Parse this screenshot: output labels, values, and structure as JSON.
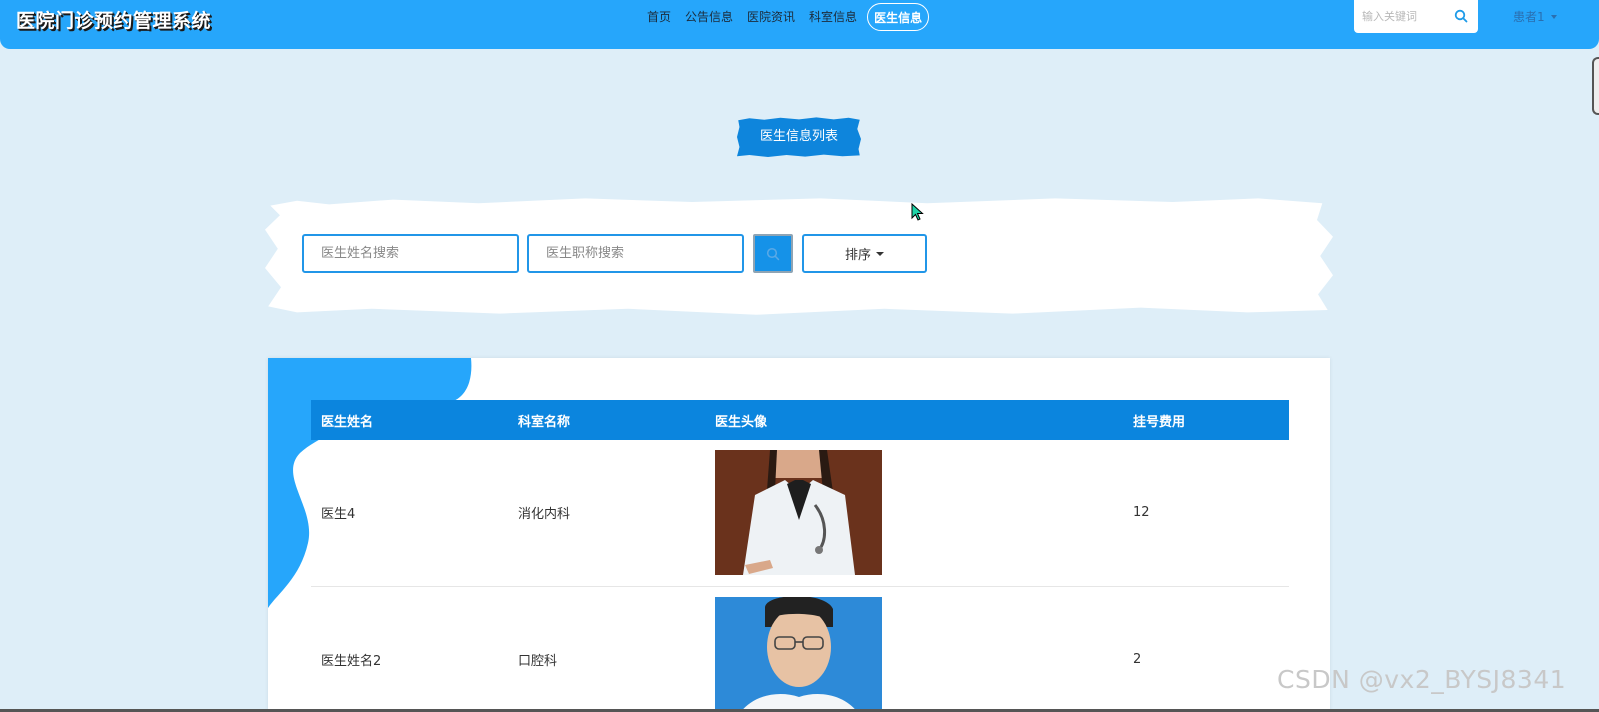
{
  "header": {
    "brand": "医院门诊预约管理系统",
    "nav": [
      {
        "label": "首页"
      },
      {
        "label": "公告信息"
      },
      {
        "label": "医院资讯"
      },
      {
        "label": "科室信息"
      },
      {
        "label": "医生信息",
        "active": true
      }
    ],
    "search_placeholder": "输入关键词",
    "user": "患者1"
  },
  "page": {
    "title": "医生信息列表"
  },
  "filters": {
    "name_placeholder": "医生姓名搜索",
    "title_placeholder": "医生职称搜索",
    "sort_label": "排序"
  },
  "table": {
    "columns": [
      "医生姓名",
      "科室名称",
      "医生头像",
      "挂号费用"
    ],
    "rows": [
      {
        "name": "医生4",
        "dept": "消化内科",
        "fee": "12"
      },
      {
        "name": "医生姓名2",
        "dept": "口腔科",
        "fee": "2"
      }
    ]
  },
  "watermark": "CSDN @vx2_BYSJ8341",
  "colors": {
    "topbar": "#26a6fb",
    "accent": "#0b85de",
    "background": "#deeef8"
  }
}
